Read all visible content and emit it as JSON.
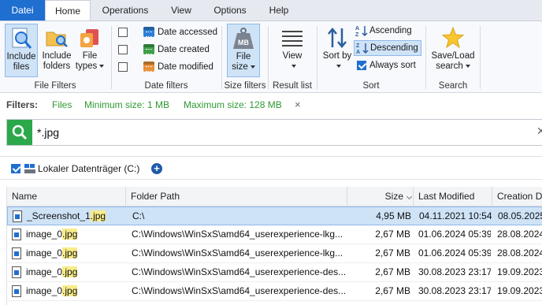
{
  "tabs": [
    {
      "label": "Datei"
    },
    {
      "label": "Home"
    },
    {
      "label": "Operations"
    },
    {
      "label": "View"
    },
    {
      "label": "Options"
    },
    {
      "label": "Help"
    }
  ],
  "ribbon": {
    "file_filters": {
      "title": "File Filters",
      "include_files": "Include files",
      "include_folders": "Include folders",
      "file_types": "File types"
    },
    "date_filters": {
      "title": "Date filters",
      "accessed": "Date accessed",
      "created": "Date created",
      "modified": "Date modified"
    },
    "size_filters": {
      "title": "Size filters",
      "file_size": "File size"
    },
    "result_list": {
      "title": "Result list",
      "view": "View"
    },
    "sort": {
      "title": "Sort",
      "sort_by": "Sort by",
      "ascending": "Ascending",
      "descending": "Descending",
      "always_sort": "Always sort"
    },
    "search": {
      "title": "Search",
      "save_load": "Save/Load search"
    }
  },
  "filters": {
    "label": "Filters:",
    "items": [
      "Files",
      "Minimum size: 1 MB",
      "Maximum size: 128 MB"
    ],
    "clear": "×"
  },
  "search": {
    "value": "*.jpg"
  },
  "location": {
    "name": "Lokaler Datenträger (C:)",
    "add": "+"
  },
  "table": {
    "columns": [
      "Name",
      "Folder Path",
      "Size",
      "Last Modified",
      "Creation D"
    ],
    "rows": [
      {
        "name_pre": "_Screenshot_1",
        "name_hl": ".jpg",
        "path": "C:\\",
        "size": "4,95 MB",
        "modified": "04.11.2021 10:54",
        "created": "08.05.2025"
      },
      {
        "name_pre": "image_0",
        "name_hl": ".jpg",
        "path": "C:\\Windows\\WinSxS\\amd64_userexperience-lkg...",
        "size": "2,67 MB",
        "modified": "01.06.2024 05:39",
        "created": "28.08.2024"
      },
      {
        "name_pre": "image_0",
        "name_hl": ".jpg",
        "path": "C:\\Windows\\WinSxS\\amd64_userexperience-lkg...",
        "size": "2,67 MB",
        "modified": "01.06.2024 05:39",
        "created": "28.08.2024"
      },
      {
        "name_pre": "image_0",
        "name_hl": ".jpg",
        "path": "C:\\Windows\\WinSxS\\amd64_userexperience-des...",
        "size": "2,67 MB",
        "modified": "30.08.2023 23:17",
        "created": "19.09.2023"
      },
      {
        "name_pre": "image_0",
        "name_hl": ".jpg",
        "path": "C:\\Windows\\WinSxS\\amd64_userexperience-des...",
        "size": "2,67 MB",
        "modified": "30.08.2023 23:17",
        "created": "19.09.2023"
      }
    ]
  },
  "colors": {
    "accent": "#1f6fd0",
    "filter_green": "#2e9a33",
    "search_green": "#2aa84a",
    "selection": "#cfe3f7",
    "highlight": "#f8ec8a"
  }
}
